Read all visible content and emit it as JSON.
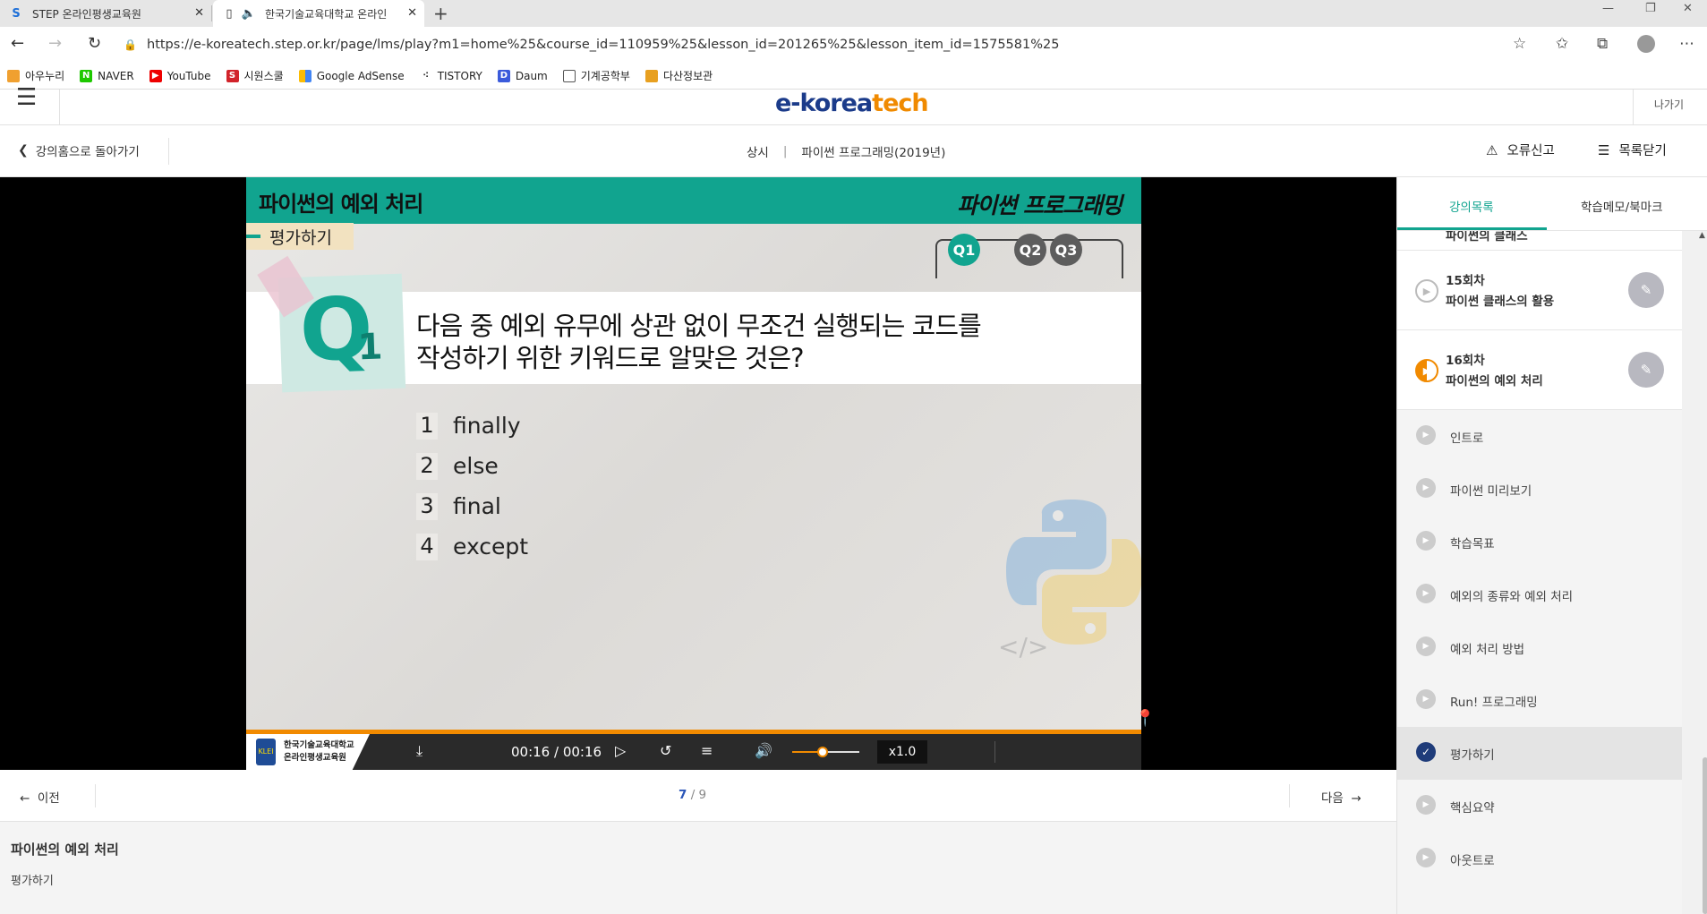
{
  "browser": {
    "tabs": [
      {
        "title": "STEP 온라인평생교육원"
      },
      {
        "title": "한국기술교육대학교 온라인"
      }
    ],
    "url": "https://e-koreatech.step.or.kr/page/lms/play?m1=home%25&course_id=110959%25&lesson_id=201265%25&lesson_item_id=1575581%25",
    "bookmarks": [
      "아우누리",
      "NAVER",
      "YouTube",
      "시원스쿨",
      "Google AdSense",
      "TISTORY",
      "Daum",
      "기계공학부",
      "다산정보관"
    ]
  },
  "site": {
    "logo_main": "e-korea",
    "logo_accent": "tech",
    "exit_label": "나가기",
    "back_label": "강의홈으로 돌아가기",
    "course_type": "상시",
    "course_name": "파이썬 프로그래밍(2019년)",
    "report_label": "오류신고",
    "toc_close_label": "목록닫기"
  },
  "slide": {
    "title": "파이썬의 예외 처리",
    "brand": "파이썬 프로그래밍",
    "section": "평가하기",
    "q_tabs": [
      "Q1",
      "Q2",
      "Q3"
    ],
    "active_q": "Q1",
    "badge_q": "Q",
    "badge_num": "1",
    "question_line1": "다음 중 예외 유무에 상관 없이 무조건 실행되는 코드를",
    "question_line2": "작성하기 위한 키워드로 알맞은 것은?",
    "options": [
      {
        "num": "1",
        "text": "finally"
      },
      {
        "num": "2",
        "text": "else"
      },
      {
        "num": "3",
        "text": "final"
      },
      {
        "num": "4",
        "text": "except"
      }
    ],
    "code_tag": "</>"
  },
  "player": {
    "logo_line1": "한국기술교육대학교",
    "logo_line2": "온라인평생교육원",
    "logo_emblem": "KLEI",
    "time": "00:16 / 00:16",
    "speed": "x1.0",
    "progress": 1.0,
    "volume": 0.45
  },
  "pager": {
    "prev": "이전",
    "next": "다음",
    "current": "7",
    "total": "/ 9"
  },
  "lesson": {
    "title": "파이썬의 예외 처리",
    "subtitle": "평가하기"
  },
  "sidebar": {
    "tabs": [
      "강의목록",
      "학습메모/북마크"
    ],
    "partial_title": "파이썬의 클래스",
    "sessions": [
      {
        "no": "15회차",
        "title": "파이썬 클래스의 활용",
        "state": "none"
      },
      {
        "no": "16회차",
        "title": "파이썬의 예외 처리",
        "state": "half"
      }
    ],
    "items": [
      {
        "label": "인트로",
        "state": "none"
      },
      {
        "label": "파이썬 미리보기",
        "state": "none"
      },
      {
        "label": "학습목표",
        "state": "none"
      },
      {
        "label": "예외의 종류와 예외 처리",
        "state": "none"
      },
      {
        "label": "예외 처리 방법",
        "state": "none"
      },
      {
        "label": "Run! 프로그래밍",
        "state": "none"
      },
      {
        "label": "평가하기",
        "state": "done"
      },
      {
        "label": "핵심요약",
        "state": "none"
      },
      {
        "label": "아웃트로",
        "state": "none"
      }
    ]
  },
  "colors": {
    "brand_green": "#11a48f",
    "orange": "#f18a00",
    "navy": "#1f3c7a"
  }
}
